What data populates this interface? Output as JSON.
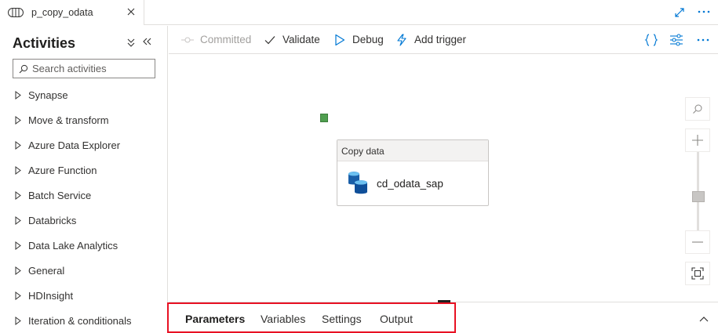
{
  "tab": {
    "title": "p_copy_odata"
  },
  "left_panel": {
    "title": "Activities",
    "search_placeholder": "Search activities",
    "categories": [
      "Synapse",
      "Move & transform",
      "Azure Data Explorer",
      "Azure Function",
      "Batch Service",
      "Databricks",
      "Data Lake Analytics",
      "General",
      "HDInsight",
      "Iteration & conditionals"
    ]
  },
  "toolbar": {
    "committed": "Committed",
    "validate": "Validate",
    "debug": "Debug",
    "add_trigger": "Add trigger"
  },
  "canvas": {
    "node": {
      "type": "Copy data",
      "name": "cd_odata_sap"
    }
  },
  "bottom_tabs": [
    "Parameters",
    "Variables",
    "Settings",
    "Output"
  ],
  "colors": {
    "accent": "#0078d4",
    "highlight": "#e81123",
    "port": "#4f9e4f"
  }
}
